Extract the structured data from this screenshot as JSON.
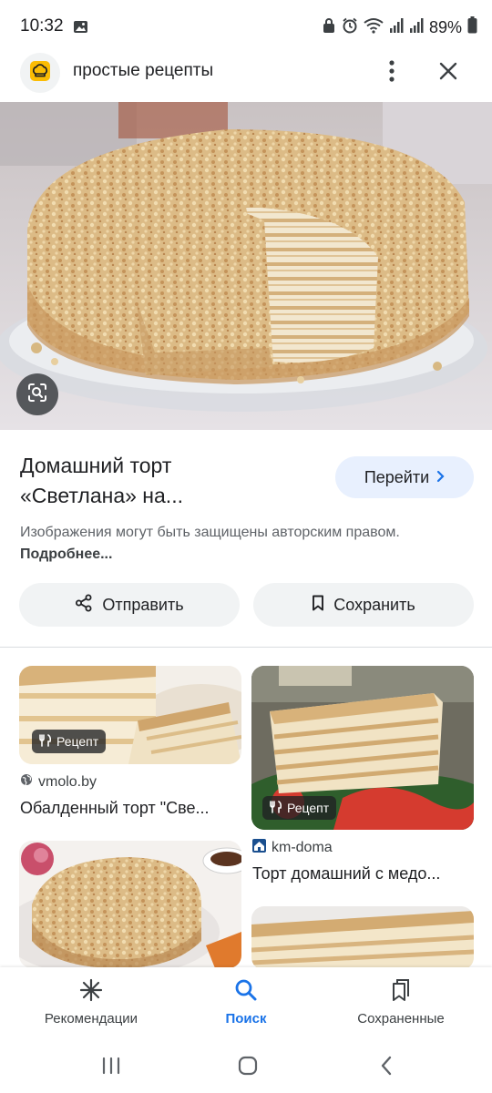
{
  "status": {
    "time": "10:32",
    "battery": "89%"
  },
  "header": {
    "site_name": "простые рецепты"
  },
  "result": {
    "title_line1": "Домашний торт",
    "title_line2": "«Светлана» на...",
    "go_label": "Перейти",
    "copyright_text": "Изображения могут быть защищены авторским правом.",
    "more_link": "Подробнее..."
  },
  "actions": {
    "share_label": "Отправить",
    "save_label": "Сохранить"
  },
  "related": [
    {
      "source": "vmolo.by",
      "title": "Обалденный торт \"Све...",
      "badge": "Рецепт"
    },
    {
      "source": "km-doma",
      "title": "Торт домашний с медо...",
      "badge": "Рецепт"
    }
  ],
  "bottom_nav": {
    "items": [
      {
        "label": "Рекомендации",
        "icon": "asterisk-icon"
      },
      {
        "label": "Поиск",
        "icon": "search-icon",
        "active": true
      },
      {
        "label": "Сохраненные",
        "icon": "bookmarks-icon"
      }
    ]
  },
  "colors": {
    "accent": "#1a73e8",
    "logo_yellow": "#fbbc04",
    "go_button_bg": "#e8f0fe"
  }
}
